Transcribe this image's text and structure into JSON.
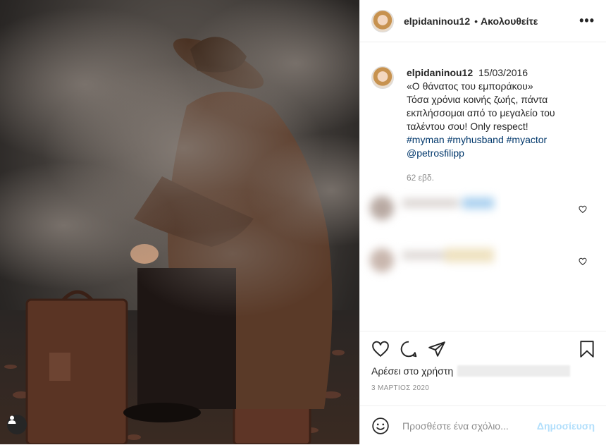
{
  "header": {
    "username": "elpidaninou12",
    "separator": "•",
    "follow_label": "Ακολουθείτε",
    "more_icon": "more-options-icon",
    "more_label": "•••"
  },
  "caption": {
    "username": "elpidaninou12",
    "date": "15/03/2016",
    "line1": "«Ο θάνατος του εμποράκου»",
    "line2": "Τόσα χρόνια κοινής ζωής, πάντα εκπλήσσομαι από το μεγαλείο του ταλέντου σου! Only respect!",
    "tag1": "#myman",
    "tag2": "#myhusband",
    "tag3": "#myactor",
    "mention": "@petrosfilipp",
    "age": "62 εβδ."
  },
  "actions": {
    "like_icon": "heart-icon",
    "comment_icon": "comment-icon",
    "share_icon": "share-icon",
    "save_icon": "bookmark-icon",
    "likes_prefix": "Αρέσει στο χρήστη",
    "post_date": "3 ΜΑΡΤΙΟΣ 2020"
  },
  "comment_box": {
    "emoji_icon": "emoji-icon",
    "placeholder": "Προσθέστε ένα σχόλιο...",
    "post_label": "Δημοσίευση"
  },
  "colors": {
    "link": "#00376b",
    "muted": "#8e8e8e",
    "post_disabled": "#b2dffc"
  }
}
